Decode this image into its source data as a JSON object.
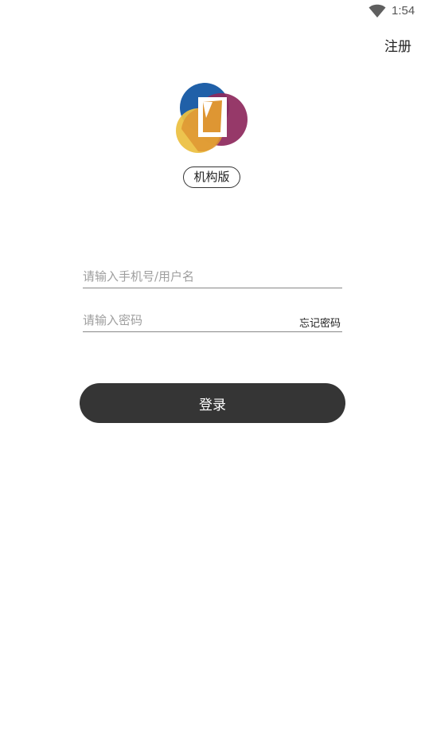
{
  "status_bar": {
    "time": "1:54",
    "wifi_icon": "wifi-icon"
  },
  "header": {
    "register_label": "注册"
  },
  "logo": {
    "icon": "app-logo-icon",
    "colors": {
      "blue": "#2060a8",
      "purple": "#8e2a5e",
      "yellow": "#ecc043",
      "orange": "#de9633"
    }
  },
  "badge": {
    "label": "机构版"
  },
  "form": {
    "phone_placeholder": "请输入手机号/用户名",
    "phone_value": "",
    "password_placeholder": "请输入密码",
    "password_value": "",
    "forgot_label": "忘记密码",
    "login_label": "登录"
  },
  "colors": {
    "button_bg": "#353535",
    "divider": "#888888",
    "placeholder": "#9e9e9e"
  }
}
